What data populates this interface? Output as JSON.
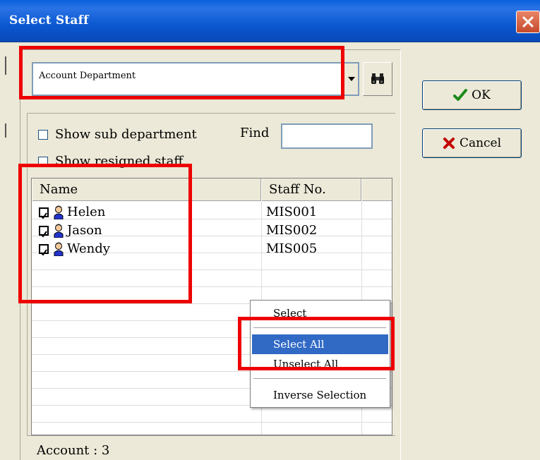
{
  "window": {
    "title": "Select Staff"
  },
  "department": {
    "selected": "Account Department"
  },
  "options": {
    "show_sub_department": "Show sub department",
    "show_resigned_staff": "Show resigned staff"
  },
  "find": {
    "label": "Find",
    "value": ""
  },
  "list": {
    "columns": {
      "name": "Name",
      "staff_no": "Staff No."
    },
    "rows": [
      {
        "name": "Helen",
        "staff_no": "MIS001",
        "checked": true
      },
      {
        "name": "Jason",
        "staff_no": "MIS002",
        "checked": true
      },
      {
        "name": "Wendy",
        "staff_no": "MIS005",
        "checked": true
      }
    ]
  },
  "status": {
    "text": "Account : 3"
  },
  "buttons": {
    "ok": "OK",
    "cancel": "Cancel"
  },
  "context_menu": {
    "items": [
      {
        "label": "Select"
      },
      {
        "label": "Select All",
        "highlighted": true
      },
      {
        "label": "Unselect All"
      },
      {
        "label": "Inverse Selection"
      }
    ]
  },
  "colors": {
    "title_bar": "#0a5fdc",
    "highlight": "#ee0000",
    "menu_selection": "#316ac5",
    "dialog_background": "#ece9d8"
  },
  "icons": {
    "find_department": "binoculars-icon",
    "ok": "checkmark-icon",
    "cancel": "x-icon",
    "staff": "person-icon",
    "close": "close-icon"
  }
}
